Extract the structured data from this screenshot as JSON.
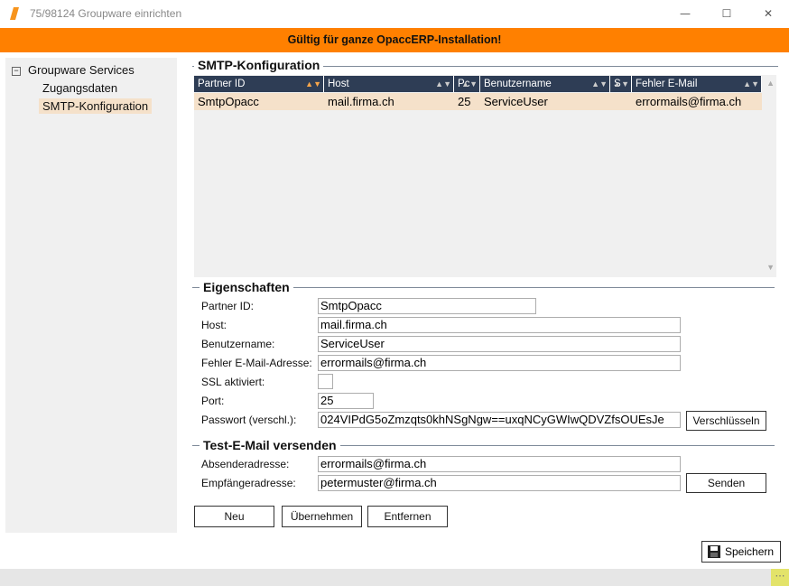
{
  "window": {
    "title": "75/98124 Groupware einrichten",
    "minimize_glyph": "—",
    "maximize_glyph": "☐",
    "close_glyph": "✕",
    "icon": "app-logo-icon"
  },
  "banner": {
    "text": "Gültig für ganze OpaccERP-Installation!",
    "color": "#ff8000"
  },
  "sidebar": {
    "root": {
      "toggle": "−",
      "label": "Groupware Services"
    },
    "items": [
      {
        "label": "Zugangsdaten",
        "selected": false
      },
      {
        "label": "SMTP-Konfiguration",
        "selected": true
      }
    ]
  },
  "smtp": {
    "section_title": "SMTP-Konfiguration",
    "columns": [
      "Partner ID",
      "Host",
      "Pc",
      "Benutzername",
      "S",
      "Fehler E-Mail"
    ],
    "rows": [
      {
        "partner_id": "SmtpOpacc",
        "host": "mail.firma.ch",
        "port": "25",
        "user": "ServiceUser",
        "ssl": "",
        "error_mail": "errormails@firma.ch"
      }
    ]
  },
  "properties": {
    "section_title": "Eigenschaften",
    "partner_id": {
      "label": "Partner ID:",
      "value": "SmtpOpacc"
    },
    "host": {
      "label": "Host:",
      "value": "mail.firma.ch"
    },
    "user": {
      "label": "Benutzername:",
      "value": "ServiceUser"
    },
    "error_mail": {
      "label": "Fehler E-Mail-Adresse:",
      "value": "errormails@firma.ch"
    },
    "ssl": {
      "label": "SSL aktiviert:",
      "checked": false
    },
    "port": {
      "label": "Port:",
      "value": "25"
    },
    "password": {
      "label": "Passwort (verschl.):",
      "value": "024VIPdG5oZmzqts0khNSgNgw==uxqNCyGWIwQDVZfsOUEsJe"
    },
    "encrypt_button": "Verschlüsseln"
  },
  "test_mail": {
    "section_title": "Test-E-Mail versenden",
    "sender": {
      "label": "Absenderadresse:",
      "value": "errormails@firma.ch"
    },
    "recipient": {
      "label": "Empfängeradresse:",
      "value": "petermuster@firma.ch"
    },
    "send_button": "Senden"
  },
  "actions": {
    "new": "Neu",
    "apply": "Übernehmen",
    "remove": "Entfernen"
  },
  "footer": {
    "save": "Speichern",
    "grip": "⋯"
  }
}
